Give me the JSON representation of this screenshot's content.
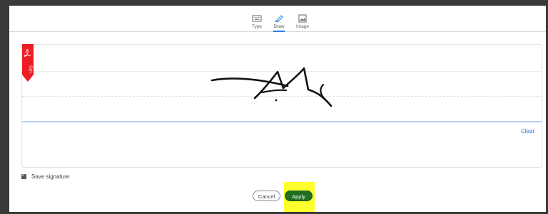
{
  "tabs": [
    {
      "label": "Type",
      "icon": "keyboard-icon"
    },
    {
      "label": "Draw",
      "icon": "pen-icon",
      "active": true
    },
    {
      "label": "Image",
      "icon": "image-icon"
    }
  ],
  "canvas": {
    "clear_label": "Clear",
    "tag_label": "Sign",
    "tag_icon": "acrobat-logo-icon",
    "accent_color": "#2680eb",
    "tag_color": "#ee1d25"
  },
  "save": {
    "label": "Save signature",
    "checked": true
  },
  "buttons": {
    "cancel_label": "Cancel",
    "apply_label": "Apply",
    "apply_color": "#1f6f1f"
  },
  "highlight_color": "#ffff2e"
}
